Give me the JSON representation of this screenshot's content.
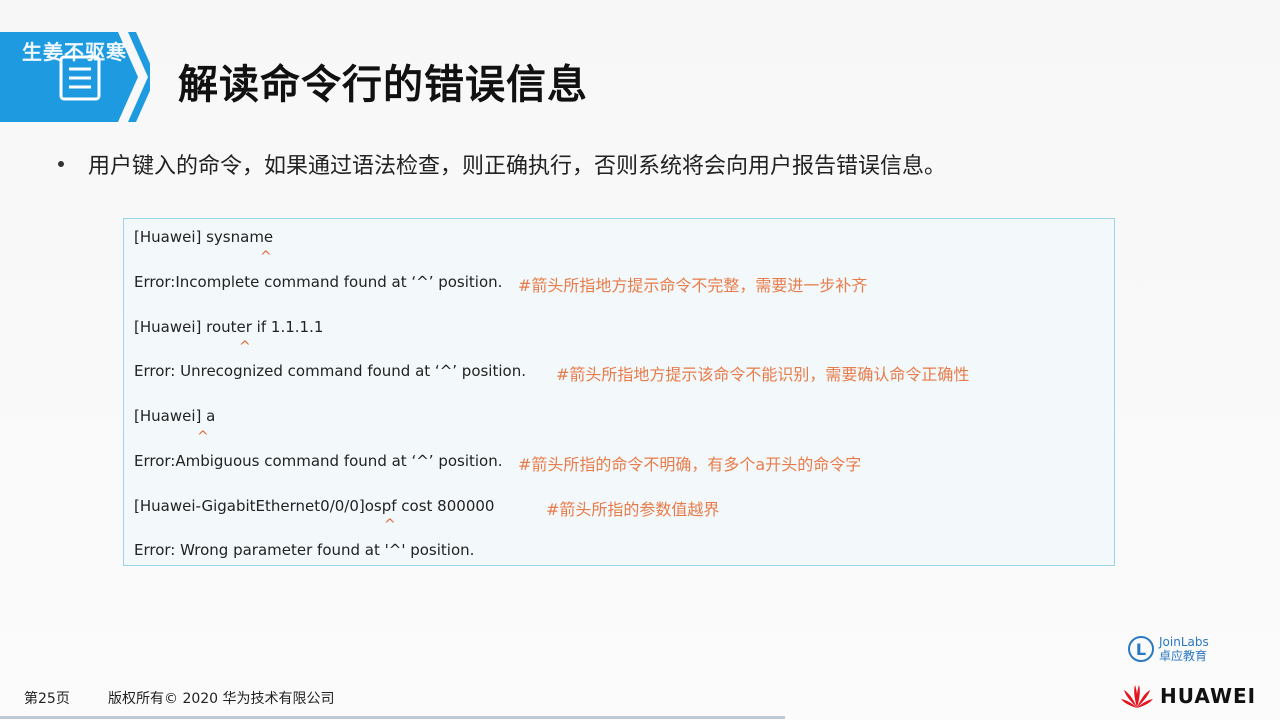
{
  "slide": {
    "watermark": "生姜不驱寒",
    "title": "解读命令行的错误信息",
    "bullet": "用户键入的命令，如果通过语法检查，则正确执行，否则系统将会向用户报告错误信息。",
    "code_lines": [
      "[Huawei] sysname",
      "Error:Incomplete command found at ‘^’ position.",
      "[Huawei] router if 1.1.1.1",
      "Error: Unrecognized command found at ‘^’ position.",
      "[Huawei] a",
      "Error:Ambiguous command found at ‘^’ position.",
      "[Huawei-GigabitEthernet0/0/0]ospf cost 800000",
      "Error: Wrong parameter found at '^' position."
    ],
    "caret": "^",
    "comments": [
      "#箭头所指地方提示命令不完整，需要进一步补齐",
      "#箭头所指地方提示该命令不能识别，需要确认命令正确性",
      "#箭头所指的命令不明确，有多个a开头的命令字",
      "#箭头所指的参数值越界"
    ]
  },
  "branding": {
    "joinlabs_name": "JoinLabs",
    "joinlabs_sub": "卓应教育",
    "joinlabs_letter": "L",
    "huawei_word": "HUAWEI"
  },
  "footer": {
    "page": "第25页",
    "copyright": "版权所有© 2020 华为技术有限公司"
  },
  "colors": {
    "banner_blue": "#1e9be0",
    "comment_orange": "#e87b4a",
    "box_border": "#9dd4e8",
    "huawei_red": "#e3141f"
  }
}
